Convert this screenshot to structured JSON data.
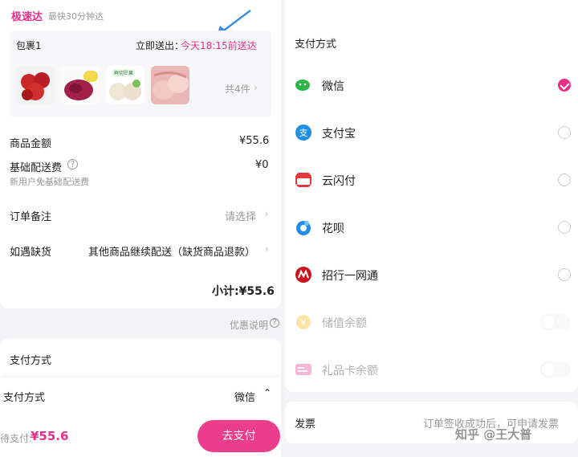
{
  "left": {
    "delivery": {
      "badge": "极速达",
      "subtitle": "最快30分钟达"
    },
    "package": {
      "name": "包裹1",
      "ship_label": "立即送出：",
      "ship_time": "今天18:15前送达",
      "thumb_label": "鲜切芒果",
      "count": "共4件"
    },
    "rows": {
      "goods_label": "商品金额",
      "goods_value": "¥55.6",
      "delivery_label": "基础配送费",
      "delivery_value": "¥0",
      "delivery_note": "新用户免基础配送费",
      "remark_label": "订单备注",
      "remark_value": "请选择",
      "stockout_label": "如遇缺货",
      "stockout_value": "其他商品继续配送（缺货商品退款）"
    },
    "subtotal": "小计:¥55.6",
    "discount_note": "优惠说明",
    "payment_section_title": "支付方式",
    "bottom_sheet": {
      "label": "支付方式",
      "value": "微信"
    },
    "footer": {
      "pending_label": "待支付:",
      "amount": "¥55.6",
      "pay_button": "去支付"
    }
  },
  "right": {
    "title": "支付方式",
    "methods": [
      {
        "label": "微信",
        "selected": true,
        "icon": "wechat-icon",
        "color": "#2fb44a"
      },
      {
        "label": "支付宝",
        "selected": false,
        "icon": "alipay-icon",
        "color": "#1f8fe5"
      },
      {
        "label": "云闪付",
        "selected": false,
        "icon": "unionpay-icon",
        "color": "#e03a3e"
      },
      {
        "label": "花呗",
        "selected": false,
        "icon": "huabei-icon",
        "color": "#1f8fe5"
      },
      {
        "label": "招行一网通",
        "selected": false,
        "icon": "cmb-icon",
        "color": "#c8161e"
      },
      {
        "label": "储值余额",
        "selected": false,
        "icon": "wallet-icon",
        "color": "#f5b400",
        "disabled": true
      },
      {
        "label": "礼品卡余额",
        "selected": false,
        "icon": "gift-card-icon",
        "color": "#e8308a",
        "disabled": true
      }
    ],
    "invoice": {
      "label": "发票",
      "note": "订单签收成功后，可申请发票"
    },
    "watermark": "知乎 @王大普"
  },
  "colors": {
    "accent": "#e8308a",
    "pay_button": "#ec3d8d",
    "annotation_arrow": "#3a8ee6"
  }
}
